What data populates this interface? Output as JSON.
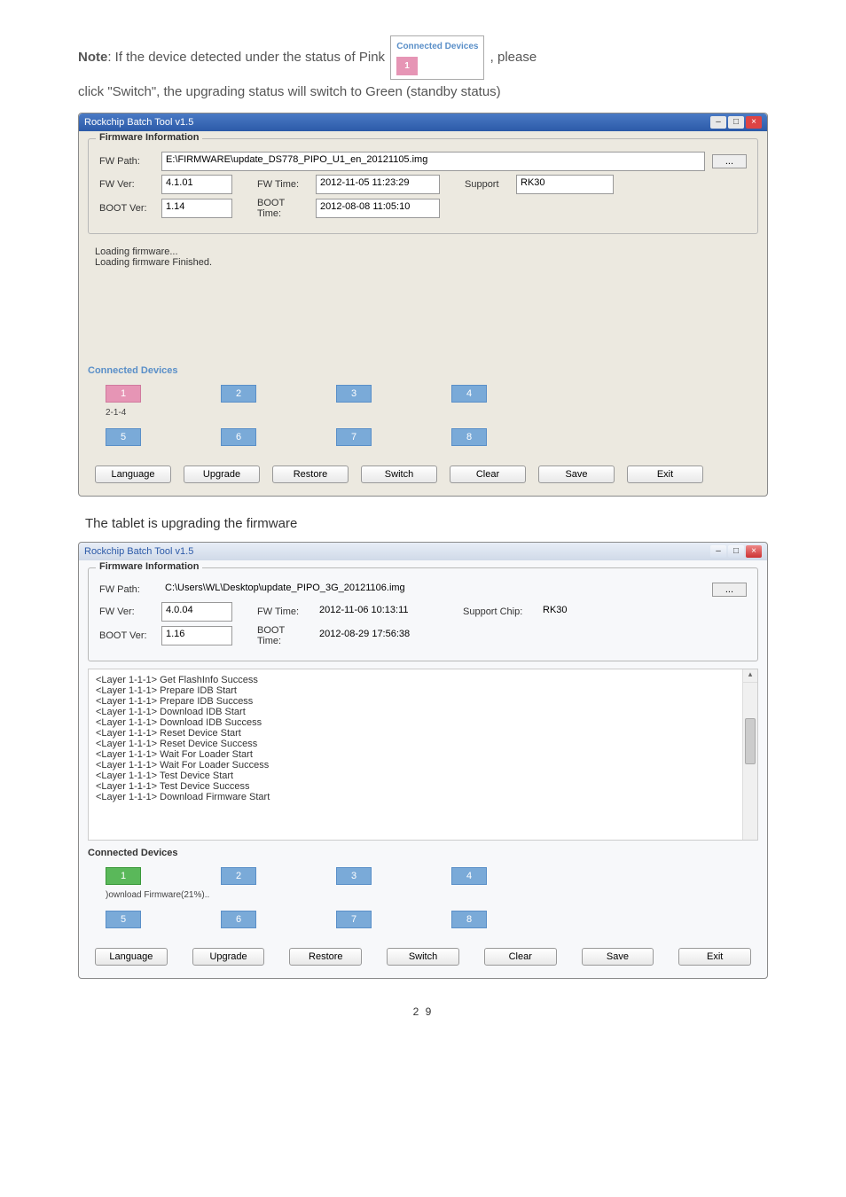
{
  "intro": {
    "note_label": "Note",
    "line1_a": ": If the device detected under the status of Pink",
    "line1_b": ", please",
    "line2": "click \"Switch\", the upgrading status will switch to Green (standby status)",
    "badge_title": "Connected Devices",
    "badge_num": "1"
  },
  "app1": {
    "title": "Rockchip Batch Tool v1.5",
    "fw_info": "Firmware Information",
    "fw_path_l": "FW Path:",
    "fw_path_v": "E:\\FIRMWARE\\update_DS778_PIPO_U1_en_20121105.img",
    "browse": "...",
    "fw_ver_l": "FW Ver:",
    "fw_ver_v": "4.1.01",
    "fw_time_l": "FW Time:",
    "fw_time_v": "2012-11-05 11:23:29",
    "support_l": "Support",
    "support_v": "RK30",
    "boot_ver_l": "BOOT Ver:",
    "boot_ver_v": "1.14",
    "boot_time_l": "BOOT Time:",
    "boot_time_v": "2012-08-08 11:05:10",
    "log": [
      "Loading firmware...",
      "Loading firmware Finished."
    ],
    "conn": "Connected Devices",
    "slot1_sub": "2-1-4",
    "slots": [
      "1",
      "2",
      "3",
      "4",
      "5",
      "6",
      "7",
      "8"
    ],
    "btn": {
      "lang": "Language",
      "up": "Upgrade",
      "res": "Restore",
      "sw": "Switch",
      "cl": "Clear",
      "sv": "Save",
      "ex": "Exit"
    }
  },
  "caption2": "The tablet is upgrading the firmware",
  "app2": {
    "title": "Rockchip Batch Tool v1.5",
    "fw_info": "Firmware Information",
    "fw_path_l": "FW Path:",
    "fw_path_v": "C:\\Users\\WL\\Desktop\\update_PIPO_3G_20121106.img",
    "browse": "...",
    "fw_ver_l": "FW Ver:",
    "fw_ver_v": "4.0.04",
    "fw_time_l": "FW Time:",
    "fw_time_v": "2012-11-06 10:13:11",
    "support_l": "Support Chip:",
    "support_v": "RK30",
    "boot_ver_l": "BOOT Ver:",
    "boot_ver_v": "1.16",
    "boot_time_l": "BOOT Time:",
    "boot_time_v": "2012-08-29 17:56:38",
    "log": [
      "<Layer 1-1-1> Get FlashInfo Success",
      "<Layer 1-1-1> Prepare IDB Start",
      "<Layer 1-1-1> Prepare IDB Success",
      "<Layer 1-1-1> Download IDB Start",
      "<Layer 1-1-1> Download IDB Success",
      "<Layer 1-1-1> Reset Device Start",
      "<Layer 1-1-1> Reset Device Success",
      "<Layer 1-1-1> Wait For Loader Start",
      "<Layer 1-1-1> Wait For Loader Success",
      "<Layer 1-1-1> Test Device Start",
      "<Layer 1-1-1> Test Device Success",
      "<Layer 1-1-1> Download Firmware Start"
    ],
    "conn": "Connected Devices",
    "slot1_sub": ")ownload Firmware(21%)..",
    "slots": [
      "1",
      "2",
      "3",
      "4",
      "5",
      "6",
      "7",
      "8"
    ],
    "btn": {
      "lang": "Language",
      "up": "Upgrade",
      "res": "Restore",
      "sw": "Switch",
      "cl": "Clear",
      "sv": "Save",
      "ex": "Exit"
    }
  },
  "pagenum": "2 9"
}
